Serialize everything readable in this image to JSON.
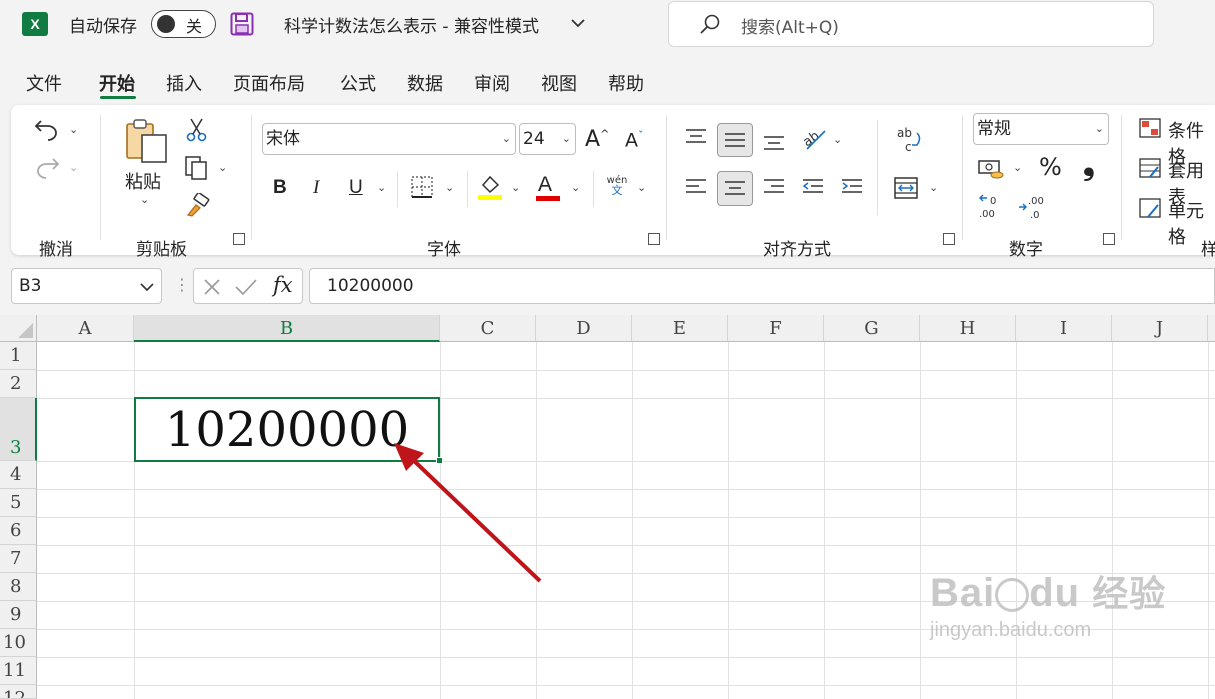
{
  "titlebar": {
    "app_icon": "excel-icon",
    "autosave_label": "自动保存",
    "autosave_state": "关",
    "save_icon": "save-icon",
    "doc_title": "科学计数法怎么表示  -  兼容性模式",
    "search_placeholder": "搜索(Alt+Q)"
  },
  "tabs": [
    {
      "label": "文件"
    },
    {
      "label": "开始",
      "active": true
    },
    {
      "label": "插入"
    },
    {
      "label": "页面布局"
    },
    {
      "label": "公式"
    },
    {
      "label": "数据"
    },
    {
      "label": "审阅"
    },
    {
      "label": "视图"
    },
    {
      "label": "帮助"
    }
  ],
  "ribbon": {
    "groups": {
      "undo": "撤消",
      "clipboard": "剪贴板",
      "font": "字体",
      "alignment": "对齐方式",
      "number": "数字",
      "styles": "样"
    },
    "paste_label": "粘贴",
    "font_name": "宋体",
    "font_size": "24",
    "number_format": "常规",
    "styles_items": [
      "条件格",
      "套用表",
      "单元格"
    ],
    "bold": "B",
    "italic": "I",
    "underline": "U",
    "grow_font": "A",
    "shrink_font": "A",
    "font_color_letter": "A",
    "phonetic": "wén",
    "phonetic_char": "文",
    "percent": "%",
    "comma": "❟",
    "highlight_color": "#ffff00",
    "font_color": "#e00000"
  },
  "formula_bar": {
    "name_box": "B3",
    "fx": "fx",
    "value": "10200000"
  },
  "grid": {
    "columns": [
      "A",
      "B",
      "C",
      "D",
      "E",
      "F",
      "G",
      "H",
      "I",
      "J"
    ],
    "rows": [
      "1",
      "2",
      "3",
      "4",
      "5",
      "6",
      "7",
      "8",
      "9",
      "10",
      "11",
      "12"
    ],
    "selected_column": "B",
    "selected_row": "3",
    "cell_b3": "10200000"
  },
  "watermark": {
    "brand": "Bai",
    "brand2": "du",
    "cn": "经验",
    "url": "jingyan.baidu.com"
  },
  "colors": {
    "accent": "#107c41",
    "arrow": "#c0141b"
  }
}
